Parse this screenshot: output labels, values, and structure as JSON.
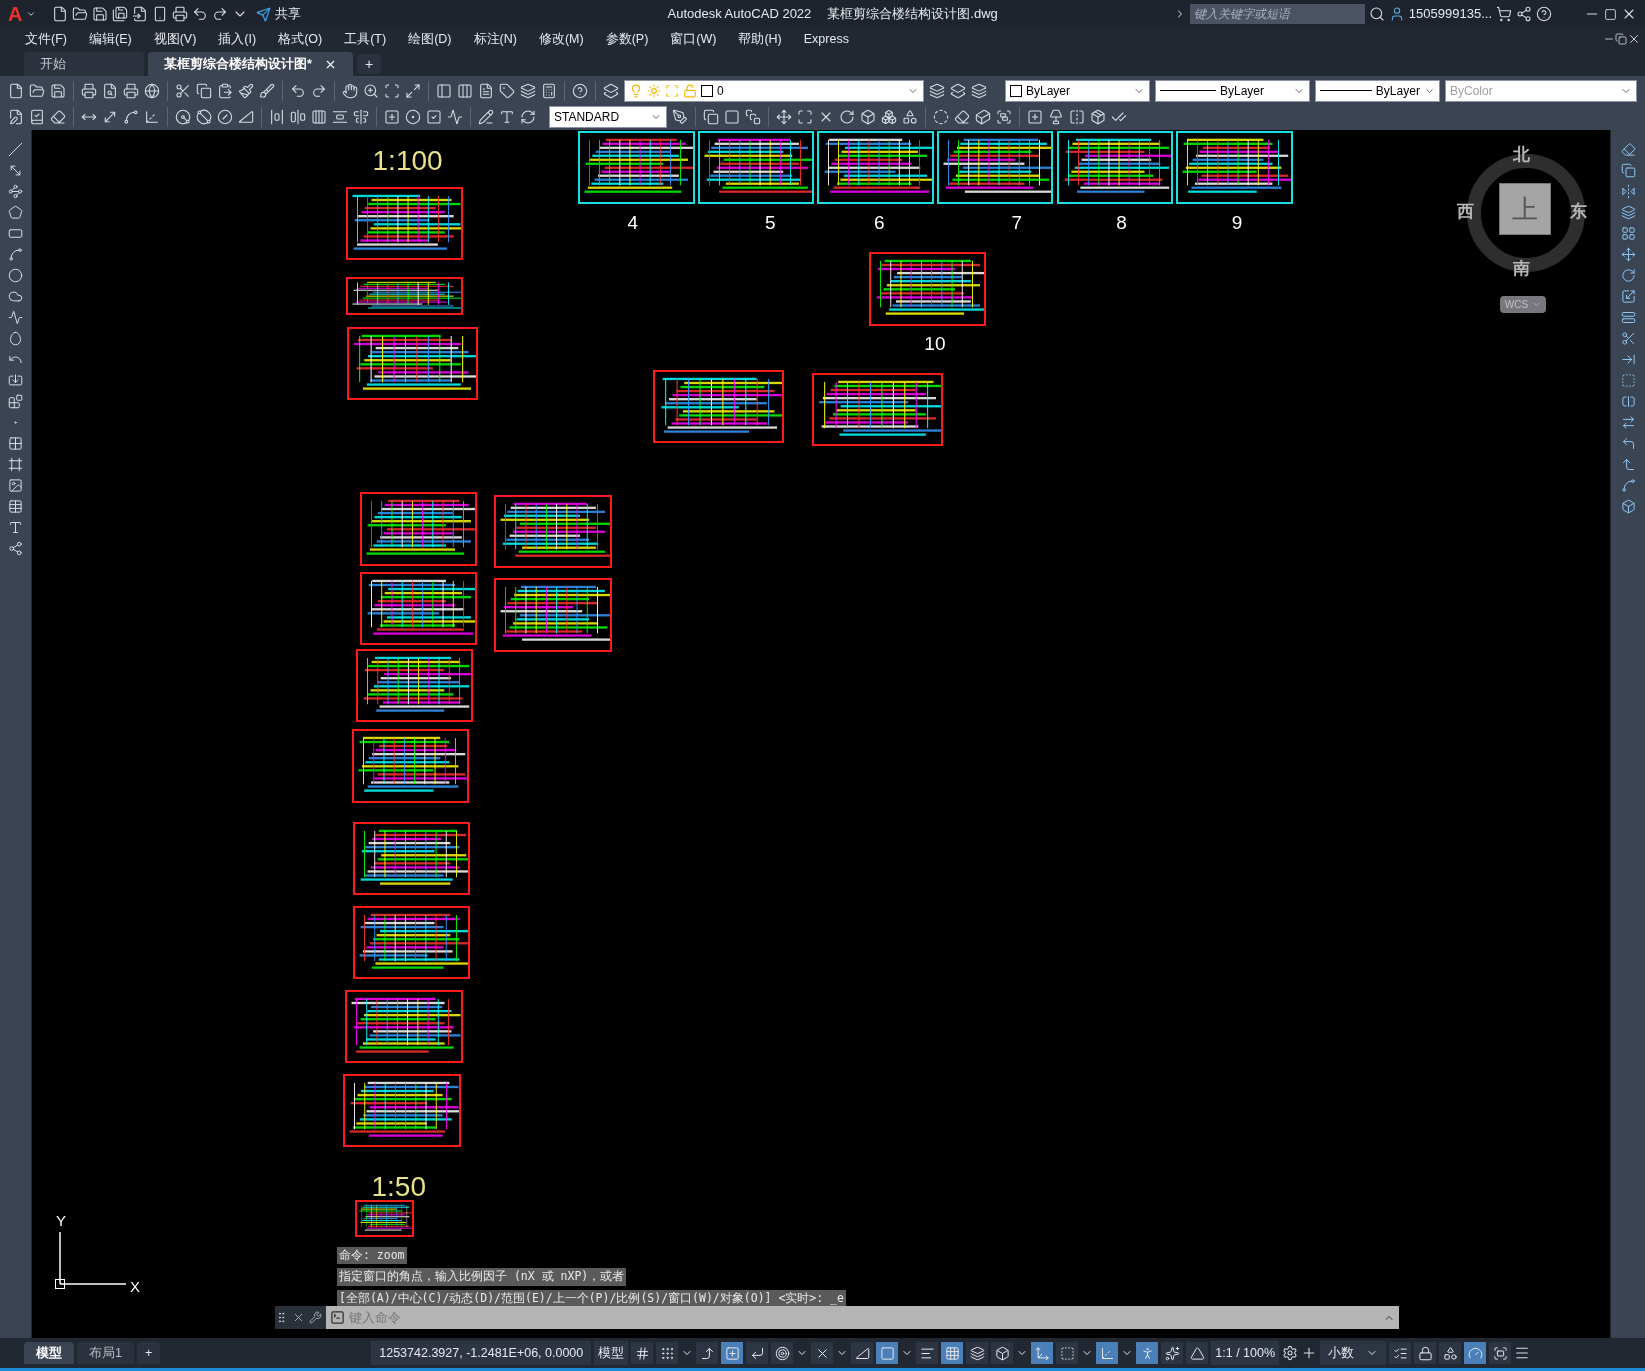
{
  "title_bar": {
    "app_menu": "A",
    "share": "共享",
    "title": "Autodesk AutoCAD 2022",
    "file_name": "某框剪综合楼结构设计图.dwg",
    "search": {
      "placeholder": "键入关键字或短语"
    },
    "user": "1505999135..."
  },
  "menu": [
    "文件(F)",
    "编辑(E)",
    "视图(V)",
    "插入(I)",
    "格式(O)",
    "工具(T)",
    "绘图(D)",
    "标注(N)",
    "修改(M)",
    "参数(P)",
    "窗口(W)",
    "帮助(H)",
    "Express"
  ],
  "doc_tabs": [
    {
      "label": "开始",
      "selected": false
    },
    {
      "label": "某框剪综合楼结构设计图*",
      "selected": true
    }
  ],
  "new_tab": "+",
  "properties_toolbar": {
    "layer": "0",
    "color_control": "ByLayer",
    "linetype": "ByLayer",
    "lineweight": "ByLayer",
    "plot_style": {
      "value": "ByColor",
      "disabled": true
    }
  },
  "style_toolbar": {
    "text_style": "STANDARD"
  },
  "canvas": {
    "scale_labels": [
      "1:100",
      "1:50"
    ],
    "sheet_numbers": [
      "4",
      "5",
      "6",
      "7",
      "8",
      "9",
      "10"
    ]
  },
  "viewcube": {
    "north": "北",
    "south": "南",
    "west": "西",
    "east": "东",
    "face": "上",
    "ucs": "WCS"
  },
  "ucs_icon": {
    "y": "Y",
    "x": "X"
  },
  "command_line": {
    "history": [
      "命令: zoom",
      "指定窗口的角点，输入比例因子 (nX 或 nXP)，或者",
      "[全部(A)/中心(C)/动态(D)/范围(E)/上一个(P)/比例(S)/窗口(W)/对象(O)] <实时>: _e"
    ],
    "placeholder": "键入命令"
  },
  "layout_tabs": [
    {
      "label": "模型",
      "selected": true
    },
    {
      "label": "布局1",
      "selected": false
    }
  ],
  "add_layout": "+",
  "status_bar": {
    "coordinates": "1253742.3927, -1.2481E+06, 0.0000",
    "space": "模型",
    "toggles": [
      {
        "on": false
      },
      {
        "on": false
      },
      {
        "on": false
      },
      {
        "on": true
      },
      {
        "on": false
      },
      {
        "on": false
      },
      {
        "on": false
      },
      {
        "on": false
      },
      {
        "on": true
      },
      {
        "on": false
      },
      {
        "on": true
      },
      {
        "on": false
      },
      {
        "on": false
      },
      {
        "on": true
      },
      {
        "on": false
      },
      {
        "on": true
      },
      {
        "on": true
      },
      {
        "on": false
      },
      {
        "on": false
      }
    ],
    "annotation_scale": "1:1 / 100%",
    "units": "小数",
    "right_toggles": [
      {
        "on": false
      },
      {
        "on": false
      },
      {
        "on": false
      },
      {
        "on": true
      },
      {
        "on": false
      }
    ]
  }
}
